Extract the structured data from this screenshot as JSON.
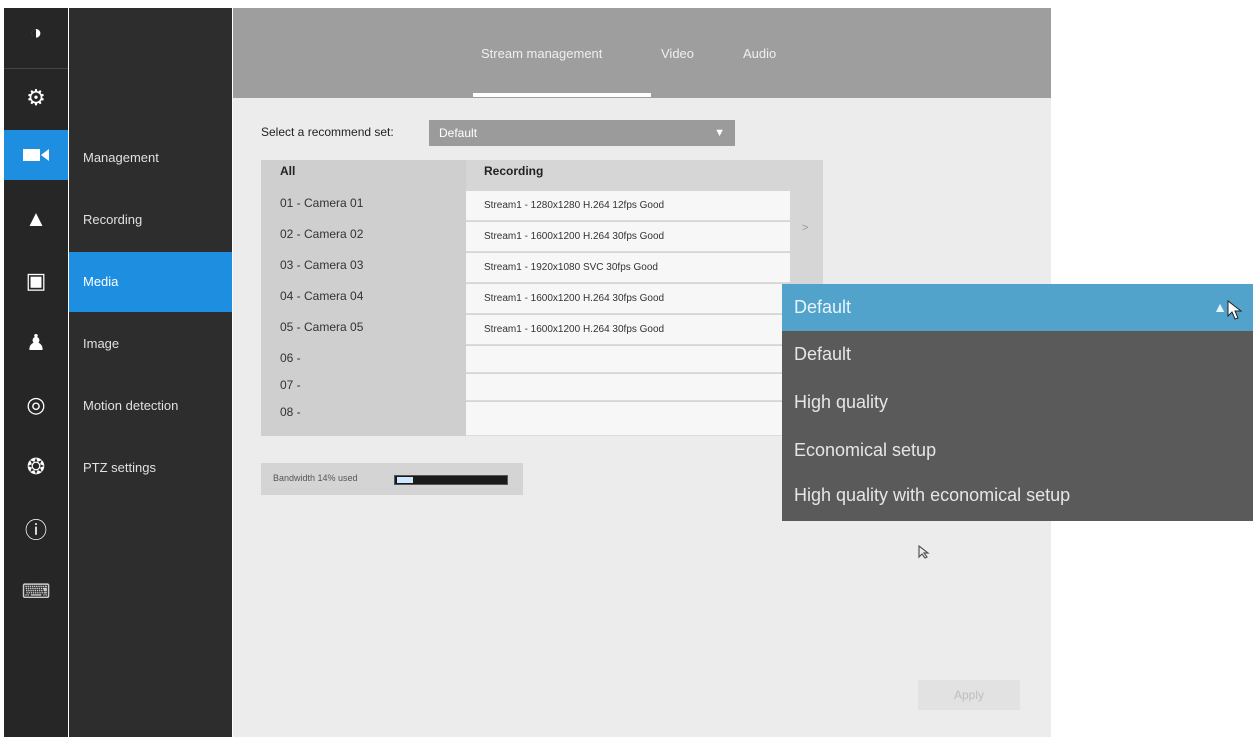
{
  "sidebar_icons": [
    {
      "name": "camera-live-icon",
      "glyph": "◑"
    },
    {
      "name": "gear-icon",
      "glyph": "⚙"
    },
    {
      "name": "video-camera-icon",
      "glyph": "▬"
    },
    {
      "name": "alert-icon",
      "glyph": "▲"
    },
    {
      "name": "monitor-icon",
      "glyph": "▣"
    },
    {
      "name": "user-icon",
      "glyph": "♟"
    },
    {
      "name": "storage-icon",
      "glyph": "◎"
    },
    {
      "name": "network-icon",
      "glyph": "❂"
    },
    {
      "name": "info-icon",
      "glyph": "ⓘ"
    },
    {
      "name": "keyboard-icon",
      "glyph": "⌨"
    }
  ],
  "subnav": {
    "items": [
      "Management",
      "Recording",
      "Media",
      "Image",
      "Motion detection",
      "PTZ settings"
    ],
    "active": "Media"
  },
  "tabs": {
    "items": [
      "Stream management",
      "Video",
      "Audio"
    ],
    "active": "Stream management"
  },
  "recommend": {
    "label": "Select a recommend set:",
    "value": "Default"
  },
  "table": {
    "col_all": "All",
    "col_recording": "Recording",
    "cameras": [
      "01 - Camera 01",
      "02 - Camera 02",
      "03 - Camera 03",
      "04 - Camera 04",
      "05 - Camera 05",
      "06 -",
      "07 -",
      "08 -"
    ],
    "streams": [
      "Stream1 - 1280x1280 H.264 12fps Good",
      "Stream1 - 1600x1200 H.264 30fps Good",
      "Stream1 - 1920x1080 SVC 30fps Good",
      "Stream1 - 1600x1200 H.264 30fps Good",
      "Stream1 - 1600x1200 H.264 30fps Good",
      "",
      "",
      ""
    ],
    "arrow": ">"
  },
  "bandwidth": {
    "label": "Bandwidth 14% used",
    "used_percent": 14
  },
  "apply_label": "Apply",
  "dropdown": {
    "selected": "Default",
    "options": [
      "Default",
      "High quality",
      "Economical setup",
      "High quality with economical setup"
    ]
  },
  "colors": {
    "accent": "#1e8fe0",
    "dropdown_highlight": "#52a3cb",
    "sidebar_bg": "#262626"
  }
}
